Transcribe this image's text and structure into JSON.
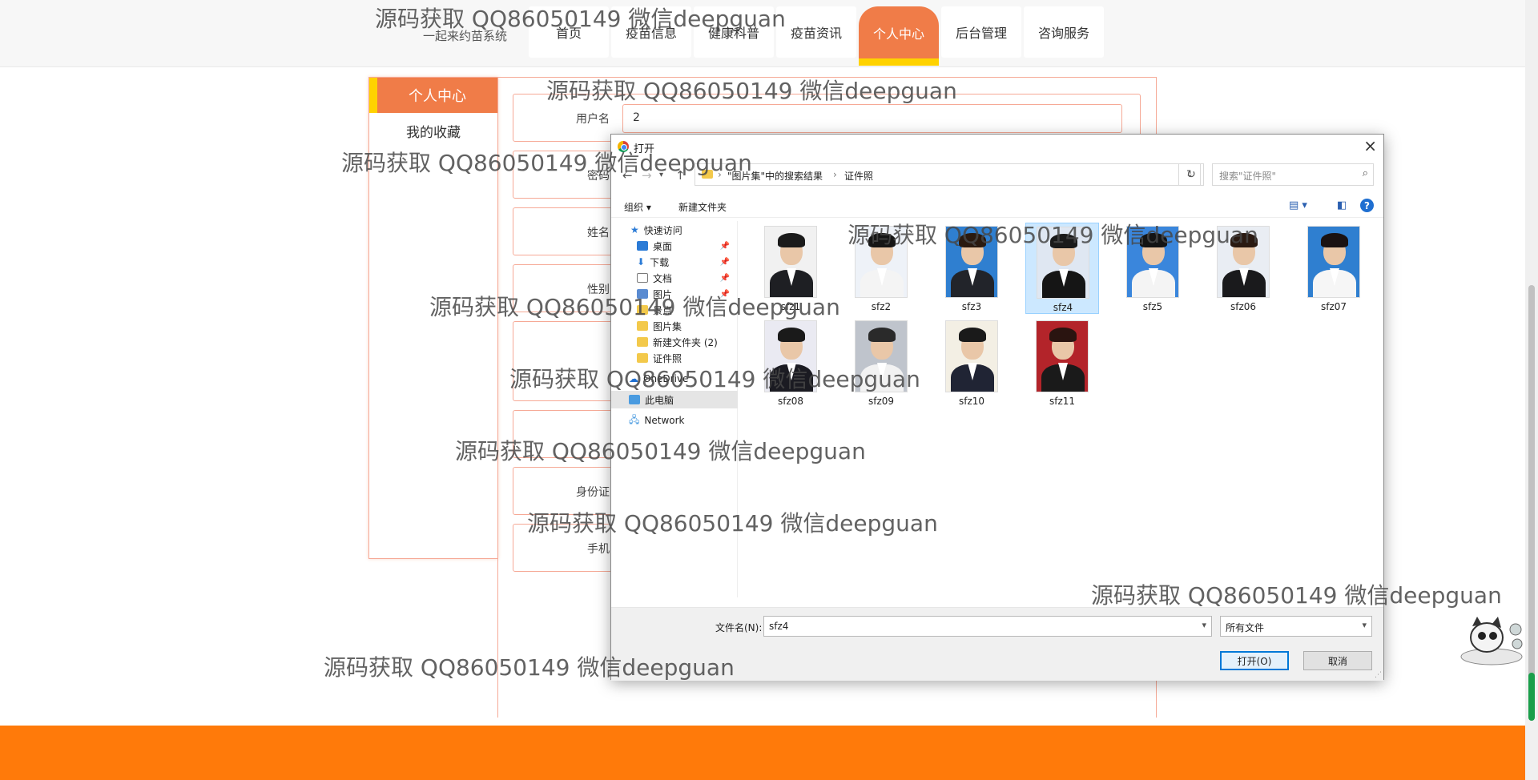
{
  "site": {
    "title": "一起来约苗系统",
    "nav": [
      "首页",
      "疫苗信息",
      "健康科普",
      "疫苗资讯",
      "个人中心",
      "后台管理",
      "咨询服务"
    ],
    "active_nav": "个人中心"
  },
  "sidebar": {
    "header": "个人中心",
    "items": [
      "我的收藏"
    ]
  },
  "form": {
    "fields": [
      {
        "label": "用户名",
        "value": "2"
      },
      {
        "label": "密码",
        "value": ""
      },
      {
        "label": "姓名",
        "value": ""
      },
      {
        "label": "性别",
        "value": ""
      },
      {
        "label": "",
        "value": ""
      },
      {
        "label": "",
        "value": ""
      },
      {
        "label": "身份证",
        "value": ""
      },
      {
        "label": "手机",
        "value": ""
      }
    ]
  },
  "dialog": {
    "title": "打开",
    "close": "×",
    "breadcrumb": [
      "\"图片集\"中的搜索结果",
      "证件照"
    ],
    "search_placeholder": "搜索\"证件照\"",
    "organize": "组织 ▾",
    "new_folder": "新建文件夹",
    "help": "?",
    "tree": [
      {
        "label": "快速访问",
        "icon": "star-icon",
        "color": "#2b7bd6"
      },
      {
        "label": "桌面",
        "icon": "desktop-icon",
        "color": "#2b7bd6",
        "pinned": true
      },
      {
        "label": "下载",
        "icon": "download-icon",
        "color": "#2b7bd6",
        "pinned": true
      },
      {
        "label": "文档",
        "icon": "document-icon",
        "color": "#7a7a7a",
        "pinned": true
      },
      {
        "label": "图片",
        "icon": "picture-icon",
        "color": "#5a8bd1",
        "pinned": true
      },
      {
        "label": "景点",
        "icon": "folder-icon",
        "color": "#f3c94b"
      },
      {
        "label": "图片集",
        "icon": "folder-icon",
        "color": "#f3c94b"
      },
      {
        "label": "新建文件夹 (2)",
        "icon": "folder-icon",
        "color": "#f3c94b"
      },
      {
        "label": "证件照",
        "icon": "folder-icon",
        "color": "#f3c94b"
      },
      {
        "label": "OneDrive",
        "icon": "cloud-icon",
        "color": "#1f6fd1"
      },
      {
        "label": "此电脑",
        "icon": "computer-icon",
        "color": "#4a9be0"
      },
      {
        "label": "Network",
        "icon": "network-icon",
        "color": "#4a9be0"
      }
    ],
    "files": [
      {
        "name": "sfz1",
        "bg": "#f1f1f1",
        "hair": "#1a1a1a",
        "body": "#1e1f23"
      },
      {
        "name": "sfz2",
        "bg": "#eef2f8",
        "hair": "#161616",
        "body": "#f4f4f4"
      },
      {
        "name": "sfz3",
        "bg": "#2f7fd0",
        "hair": "#2a1a10",
        "body": "#22242a"
      },
      {
        "name": "sfz4",
        "bg": "#dfe7f2",
        "hair": "#1a1a1a",
        "body": "#151515"
      },
      {
        "name": "sfz5",
        "bg": "#3a86dc",
        "hair": "#141414",
        "body": "#f4f4f4"
      },
      {
        "name": "sfz06",
        "bg": "#e9edf3",
        "hair": "#2a1a12",
        "body": "#1a1a1c"
      },
      {
        "name": "sfz07",
        "bg": "#2f7fd0",
        "hair": "#1a1212",
        "body": "#f6f6f6"
      },
      {
        "name": "sfz08",
        "bg": "#eaeaf2",
        "hair": "#1a1a1a",
        "body": "#1b1b22"
      },
      {
        "name": "sfz09",
        "bg": "#bfc4cc",
        "hair": "#2a2a2a",
        "body": "#f2f2f2"
      },
      {
        "name": "sfz10",
        "bg": "#f3efe4",
        "hair": "#1a1a1a",
        "body": "#202434"
      },
      {
        "name": "sfz11",
        "bg": "#b3242a",
        "hair": "#2a1410",
        "body": "#1a1a1a"
      }
    ],
    "selected_file": "sfz4",
    "filename_label": "文件名(N):",
    "filename_value": "sfz4",
    "filetype": "所有文件",
    "open_button": "打开(O)",
    "cancel_button": "取消"
  },
  "watermark": "源码获取 QQ86050149 微信deepguan",
  "colors": {
    "accent": "#f07c48",
    "yellow": "#ffd200",
    "footer": "#ff7a0a",
    "border": "#f6a996"
  }
}
